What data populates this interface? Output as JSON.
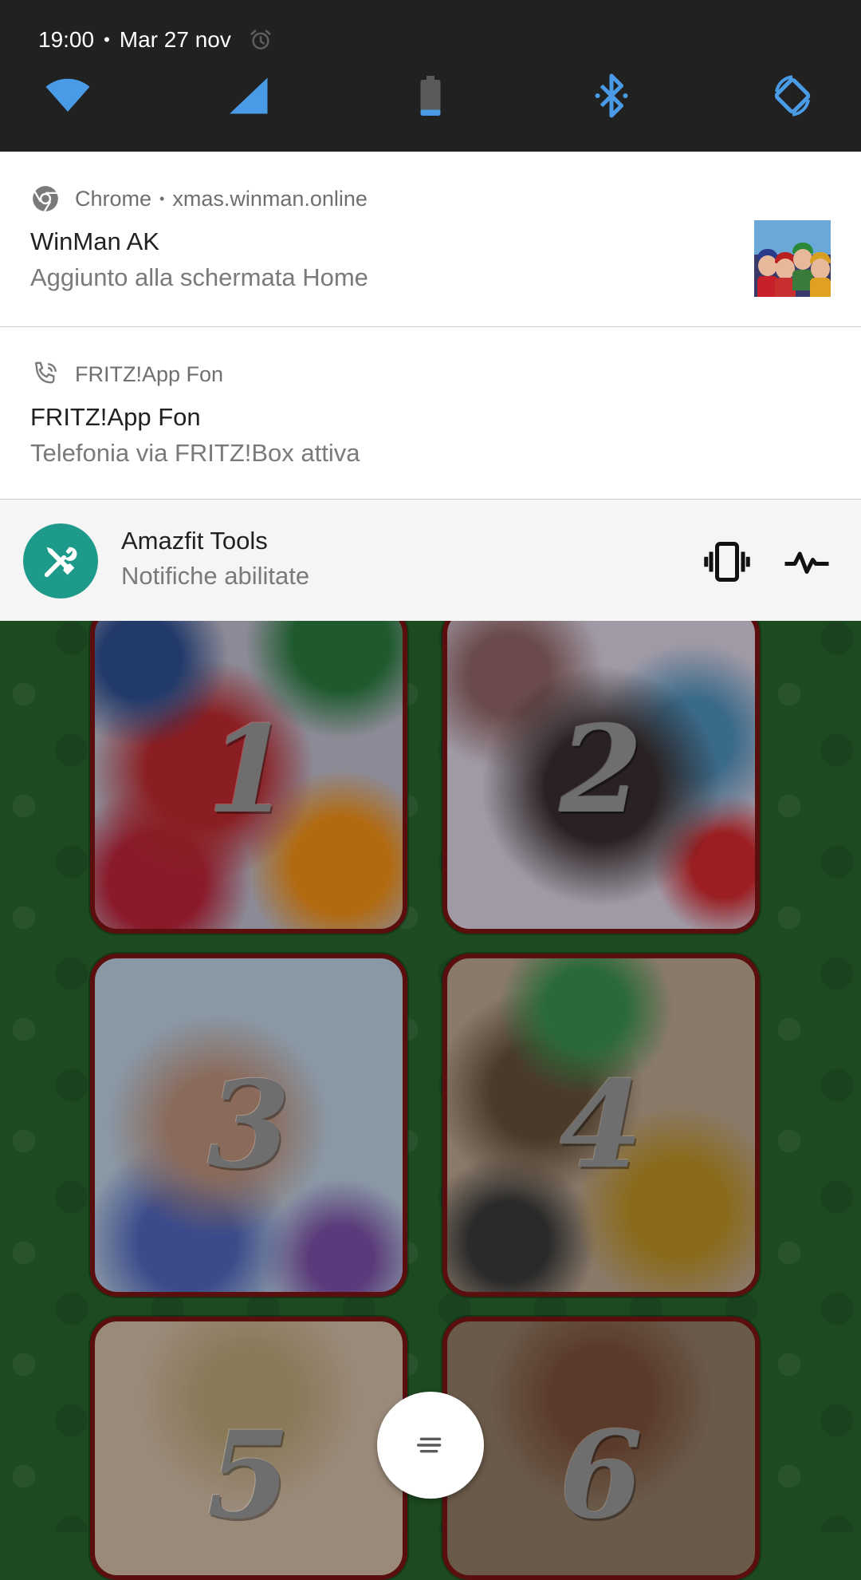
{
  "status_bar": {
    "time": "19:00",
    "separator": "•",
    "date": "Mar 27 nov",
    "alarm_icon": "alarm-clock-icon"
  },
  "quick_settings": [
    {
      "name": "wifi",
      "icon": "wifi-icon",
      "color": "#4a9be6"
    },
    {
      "name": "mobile-signal",
      "icon": "signal-icon",
      "color": "#4a9be6"
    },
    {
      "name": "battery",
      "icon": "battery-icon",
      "color": "#4a9be6"
    },
    {
      "name": "bluetooth",
      "icon": "bluetooth-icon",
      "color": "#4a9be6"
    },
    {
      "name": "auto-rotate",
      "icon": "rotate-icon",
      "color": "#4a9be6"
    }
  ],
  "notifications": {
    "chrome": {
      "app": "Chrome",
      "separator": "•",
      "source": "xmas.winman.online",
      "title": "WinMan AK",
      "text": "Aggiunto alla schermata Home"
    },
    "fritz": {
      "app": "FRITZ!App Fon",
      "title": "FRITZ!App Fon",
      "text": "Telefonia via FRITZ!Box attiva"
    },
    "amazfit": {
      "title": "Amazfit Tools",
      "text": "Notifiche abilitate",
      "icon_color": "#1d9a8a"
    }
  },
  "calendar": {
    "doors": [
      "1",
      "2",
      "3",
      "4",
      "5",
      "6"
    ]
  }
}
